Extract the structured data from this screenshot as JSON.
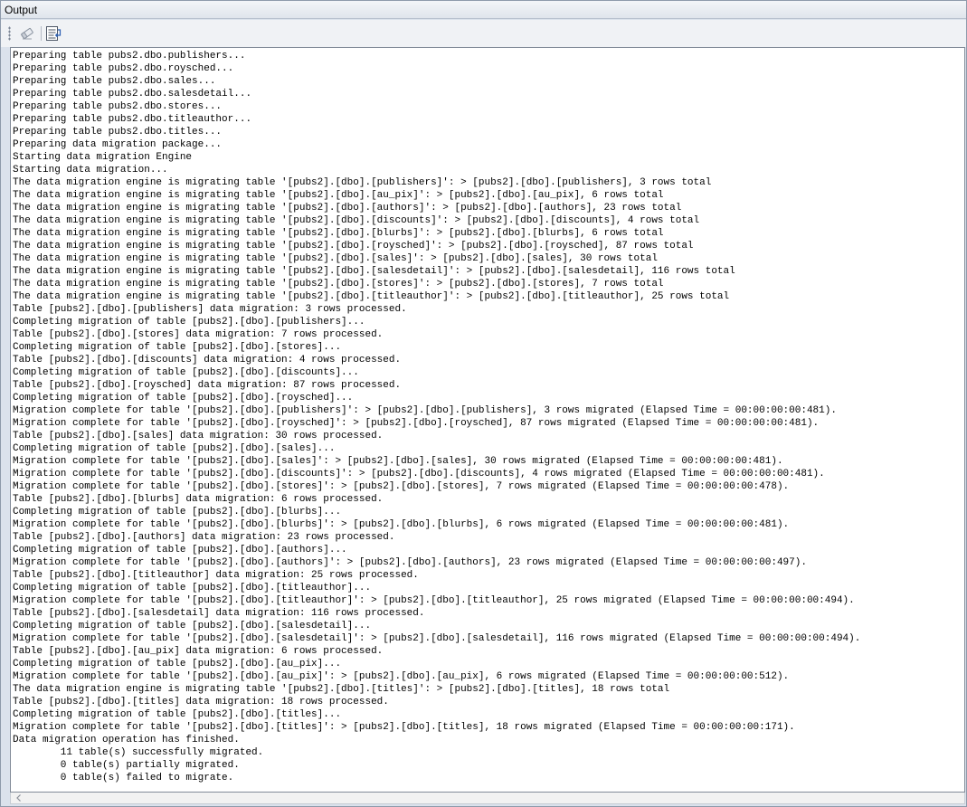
{
  "window": {
    "title": "Output"
  },
  "toolbar": {
    "buttons": [
      {
        "icon": "eraser-icon"
      },
      {
        "icon": "word-wrap-icon"
      }
    ]
  },
  "output": {
    "lines": [
      "Preparing table pubs2.dbo.publishers...",
      "Preparing table pubs2.dbo.roysched...",
      "Preparing table pubs2.dbo.sales...",
      "Preparing table pubs2.dbo.salesdetail...",
      "Preparing table pubs2.dbo.stores...",
      "Preparing table pubs2.dbo.titleauthor...",
      "Preparing table pubs2.dbo.titles...",
      "Preparing data migration package...",
      "Starting data migration Engine",
      "Starting data migration...",
      "The data migration engine is migrating table '[pubs2].[dbo].[publishers]': > [pubs2].[dbo].[publishers], 3 rows total",
      "The data migration engine is migrating table '[pubs2].[dbo].[au_pix]': > [pubs2].[dbo].[au_pix], 6 rows total",
      "The data migration engine is migrating table '[pubs2].[dbo].[authors]': > [pubs2].[dbo].[authors], 23 rows total",
      "The data migration engine is migrating table '[pubs2].[dbo].[discounts]': > [pubs2].[dbo].[discounts], 4 rows total",
      "The data migration engine is migrating table '[pubs2].[dbo].[blurbs]': > [pubs2].[dbo].[blurbs], 6 rows total",
      "The data migration engine is migrating table '[pubs2].[dbo].[roysched]': > [pubs2].[dbo].[roysched], 87 rows total",
      "The data migration engine is migrating table '[pubs2].[dbo].[sales]': > [pubs2].[dbo].[sales], 30 rows total",
      "The data migration engine is migrating table '[pubs2].[dbo].[salesdetail]': > [pubs2].[dbo].[salesdetail], 116 rows total",
      "The data migration engine is migrating table '[pubs2].[dbo].[stores]': > [pubs2].[dbo].[stores], 7 rows total",
      "The data migration engine is migrating table '[pubs2].[dbo].[titleauthor]': > [pubs2].[dbo].[titleauthor], 25 rows total",
      "Table [pubs2].[dbo].[publishers] data migration: 3 rows processed.",
      "Completing migration of table [pubs2].[dbo].[publishers]...",
      "Table [pubs2].[dbo].[stores] data migration: 7 rows processed.",
      "Completing migration of table [pubs2].[dbo].[stores]...",
      "Table [pubs2].[dbo].[discounts] data migration: 4 rows processed.",
      "Completing migration of table [pubs2].[dbo].[discounts]...",
      "Table [pubs2].[dbo].[roysched] data migration: 87 rows processed.",
      "Completing migration of table [pubs2].[dbo].[roysched]...",
      "Migration complete for table '[pubs2].[dbo].[publishers]': > [pubs2].[dbo].[publishers], 3 rows migrated (Elapsed Time = 00:00:00:00:481).",
      "Migration complete for table '[pubs2].[dbo].[roysched]': > [pubs2].[dbo].[roysched], 87 rows migrated (Elapsed Time = 00:00:00:00:481).",
      "Table [pubs2].[dbo].[sales] data migration: 30 rows processed.",
      "Completing migration of table [pubs2].[dbo].[sales]...",
      "Migration complete for table '[pubs2].[dbo].[sales]': > [pubs2].[dbo].[sales], 30 rows migrated (Elapsed Time = 00:00:00:00:481).",
      "Migration complete for table '[pubs2].[dbo].[discounts]': > [pubs2].[dbo].[discounts], 4 rows migrated (Elapsed Time = 00:00:00:00:481).",
      "Migration complete for table '[pubs2].[dbo].[stores]': > [pubs2].[dbo].[stores], 7 rows migrated (Elapsed Time = 00:00:00:00:478).",
      "Table [pubs2].[dbo].[blurbs] data migration: 6 rows processed.",
      "Completing migration of table [pubs2].[dbo].[blurbs]...",
      "Migration complete for table '[pubs2].[dbo].[blurbs]': > [pubs2].[dbo].[blurbs], 6 rows migrated (Elapsed Time = 00:00:00:00:481).",
      "Table [pubs2].[dbo].[authors] data migration: 23 rows processed.",
      "Completing migration of table [pubs2].[dbo].[authors]...",
      "Migration complete for table '[pubs2].[dbo].[authors]': > [pubs2].[dbo].[authors], 23 rows migrated (Elapsed Time = 00:00:00:00:497).",
      "Table [pubs2].[dbo].[titleauthor] data migration: 25 rows processed.",
      "Completing migration of table [pubs2].[dbo].[titleauthor]...",
      "Migration complete for table '[pubs2].[dbo].[titleauthor]': > [pubs2].[dbo].[titleauthor], 25 rows migrated (Elapsed Time = 00:00:00:00:494).",
      "Table [pubs2].[dbo].[salesdetail] data migration: 116 rows processed.",
      "Completing migration of table [pubs2].[dbo].[salesdetail]...",
      "Migration complete for table '[pubs2].[dbo].[salesdetail]': > [pubs2].[dbo].[salesdetail], 116 rows migrated (Elapsed Time = 00:00:00:00:494).",
      "Table [pubs2].[dbo].[au_pix] data migration: 6 rows processed.",
      "Completing migration of table [pubs2].[dbo].[au_pix]...",
      "Migration complete for table '[pubs2].[dbo].[au_pix]': > [pubs2].[dbo].[au_pix], 6 rows migrated (Elapsed Time = 00:00:00:00:512).",
      "The data migration engine is migrating table '[pubs2].[dbo].[titles]': > [pubs2].[dbo].[titles], 18 rows total",
      "Table [pubs2].[dbo].[titles] data migration: 18 rows processed.",
      "Completing migration of table [pubs2].[dbo].[titles]...",
      "Migration complete for table '[pubs2].[dbo].[titles]': > [pubs2].[dbo].[titles], 18 rows migrated (Elapsed Time = 00:00:00:00:171).",
      "Data migration operation has finished.",
      "        11 table(s) successfully migrated.",
      "        0 table(s) partially migrated.",
      "        0 table(s) failed to migrate."
    ]
  },
  "colors": {
    "panel_bg": "#dbe2ec",
    "text": "#000000",
    "output_bg": "#ffffff"
  }
}
